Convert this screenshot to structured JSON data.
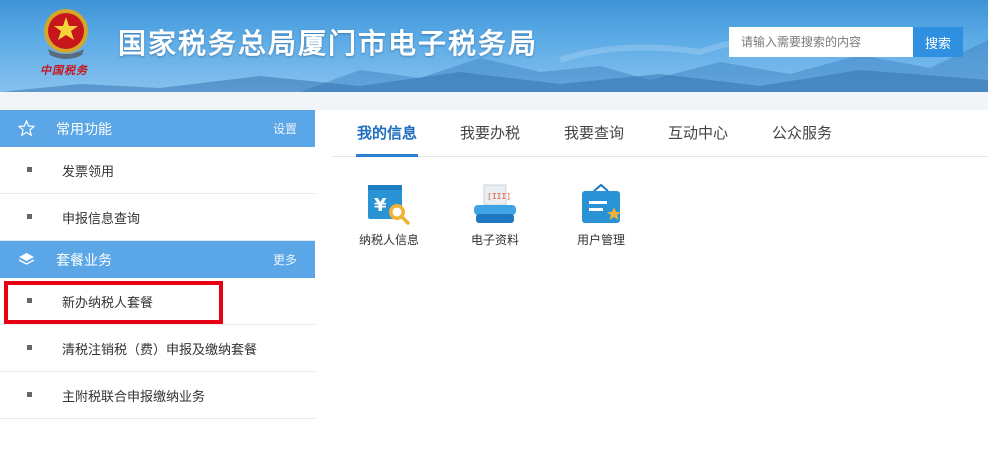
{
  "header": {
    "site_title": "国家税务总局厦门市电子税务局",
    "emblem_caption": "中国税务",
    "search_placeholder": "请输入需要搜索的内容",
    "search_button": "搜索"
  },
  "sidebar": {
    "common": {
      "title": "常用功能",
      "link": "设置",
      "icon": "star-icon",
      "items": [
        {
          "label": "发票领用"
        },
        {
          "label": "申报信息查询"
        }
      ]
    },
    "packages": {
      "title": "套餐业务",
      "link": "更多",
      "icon": "layers-icon",
      "items": [
        {
          "label": "新办纳税人套餐"
        },
        {
          "label": "清税注销税（费）申报及缴纳套餐"
        },
        {
          "label": "主附税联合申报缴纳业务"
        }
      ]
    }
  },
  "main": {
    "tabs": [
      {
        "label": "我的信息",
        "active": true
      },
      {
        "label": "我要办税"
      },
      {
        "label": "我要查询"
      },
      {
        "label": "互动中心"
      },
      {
        "label": "公众服务"
      }
    ],
    "apps": [
      {
        "label": "纳税人信息",
        "icon": "taxpayer-info-icon"
      },
      {
        "label": "电子资料",
        "icon": "scanner-icon"
      },
      {
        "label": "用户管理",
        "icon": "user-management-icon"
      }
    ]
  },
  "colors": {
    "header_blue": "#3f93d6",
    "sidebar_head": "#5aa6e6",
    "active_tab": "#1f6fbe",
    "highlight_red": "#e60012"
  }
}
